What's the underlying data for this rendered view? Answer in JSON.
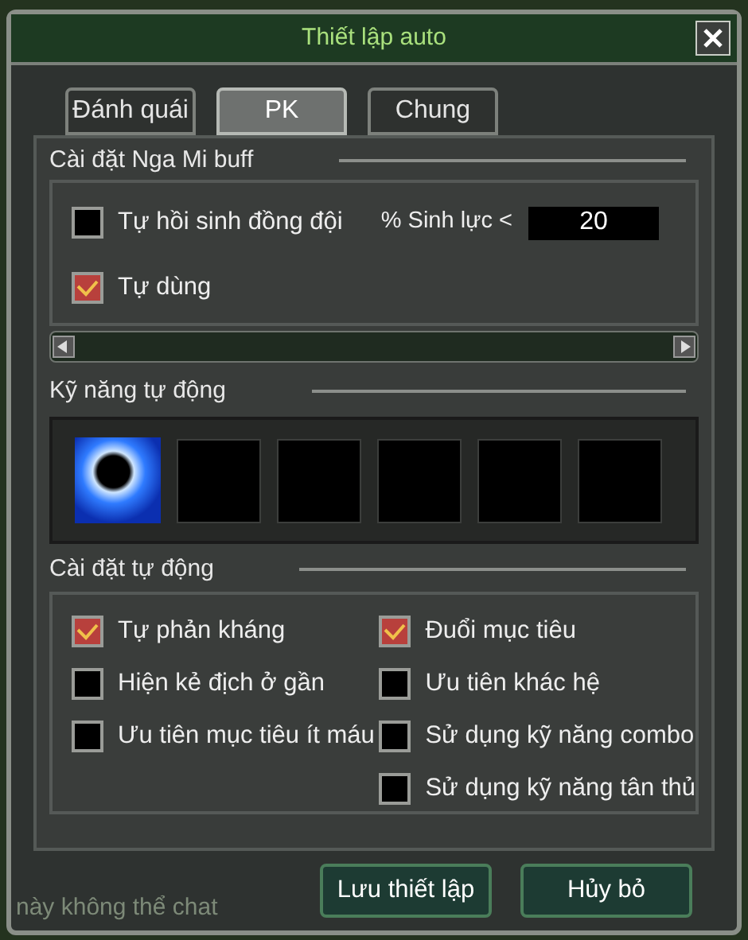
{
  "window": {
    "title": "Thiết lập auto"
  },
  "tabs": [
    {
      "label": "Đánh quái",
      "selected": false
    },
    {
      "label": "PK",
      "selected": true
    },
    {
      "label": "Chung",
      "selected": false
    }
  ],
  "buff_section": {
    "title": "Cài đặt Nga Mi buff",
    "options": [
      {
        "label": "Tự hồi sinh đồng đội",
        "checked": false
      },
      {
        "label": "Tự dùng",
        "checked": true
      }
    ],
    "hp_threshold": {
      "label": "% Sinh lực <",
      "value": "20"
    }
  },
  "skills_section": {
    "title": "Kỹ năng tự động",
    "slots": [
      {
        "filled": true
      },
      {
        "filled": false
      },
      {
        "filled": false
      },
      {
        "filled": false
      },
      {
        "filled": false
      },
      {
        "filled": false
      }
    ]
  },
  "auto_section": {
    "title": "Cài đặt tự động",
    "left_options": [
      {
        "label": "Tự phản kháng",
        "checked": true
      },
      {
        "label": "Hiện kẻ địch ở gần",
        "checked": false
      },
      {
        "label": "Ưu tiên mục tiêu ít máu",
        "checked": false
      }
    ],
    "right_options": [
      {
        "label": "Đuổi mục tiêu",
        "checked": true
      },
      {
        "label": "Ưu tiên khác hệ",
        "checked": false
      },
      {
        "label": "Sử dụng kỹ năng combo",
        "checked": false
      },
      {
        "label": "Sử dụng kỹ năng tân thủ",
        "checked": false
      }
    ]
  },
  "buttons": [
    "Lưu thiết lập",
    "Hủy bỏ"
  ],
  "background_chat": [
    "này không thể chat"
  ]
}
